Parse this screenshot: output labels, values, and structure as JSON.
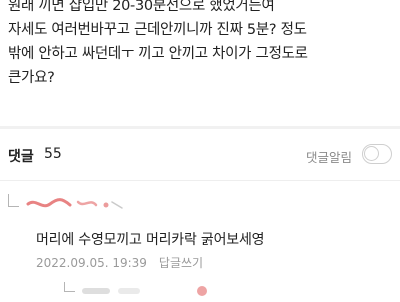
{
  "post": {
    "lines": [
      "원래 끼면 샵입만 20-30분선으로 했었거든여",
      "자세도 여러번바꾸고 근데안끼니까 진짜 5분? 정도",
      "밖에 안하고 싸던데ㅜ 끼고 안끼고 차이가 그정도로",
      "큰가요?"
    ]
  },
  "comments_header": {
    "label": "댓글",
    "count": "55",
    "alarm_label": "댓글알림",
    "alarm_on": false
  },
  "comment": {
    "text": "머리에 수영모끼고 머리카락 굵어보세영",
    "date": "2022.09.05. 19:39",
    "reply_label": "답글쓰기"
  },
  "colors": {
    "text": "#222222",
    "muted": "#9a9a9a",
    "divider": "#f1f1f1",
    "redaction": "#e05a5a"
  }
}
